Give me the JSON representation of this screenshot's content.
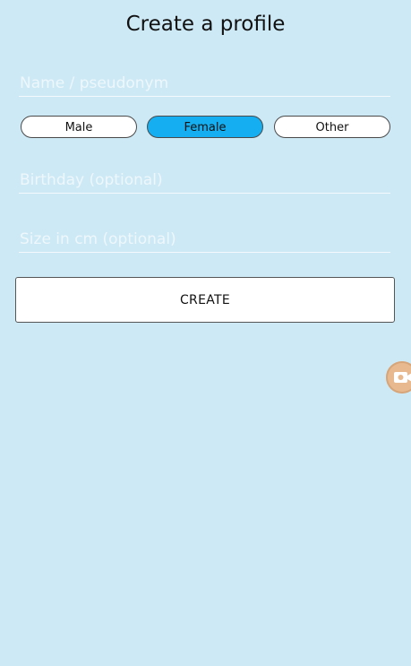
{
  "header": {
    "title": "Create a profile"
  },
  "form": {
    "name_placeholder": "Name / pseudonym",
    "birthday_placeholder": "Birthday (optional)",
    "size_placeholder": "Size in cm (optional)",
    "gender_options": [
      "Male",
      "Female",
      "Other"
    ],
    "selected_gender": "Female",
    "create_label": "CREATE"
  },
  "floating_button": {
    "icon": "camera-icon"
  },
  "colors": {
    "background": "#cde9f5",
    "selected_pill": "#15aef0",
    "floating_button": "#e8b98f"
  }
}
